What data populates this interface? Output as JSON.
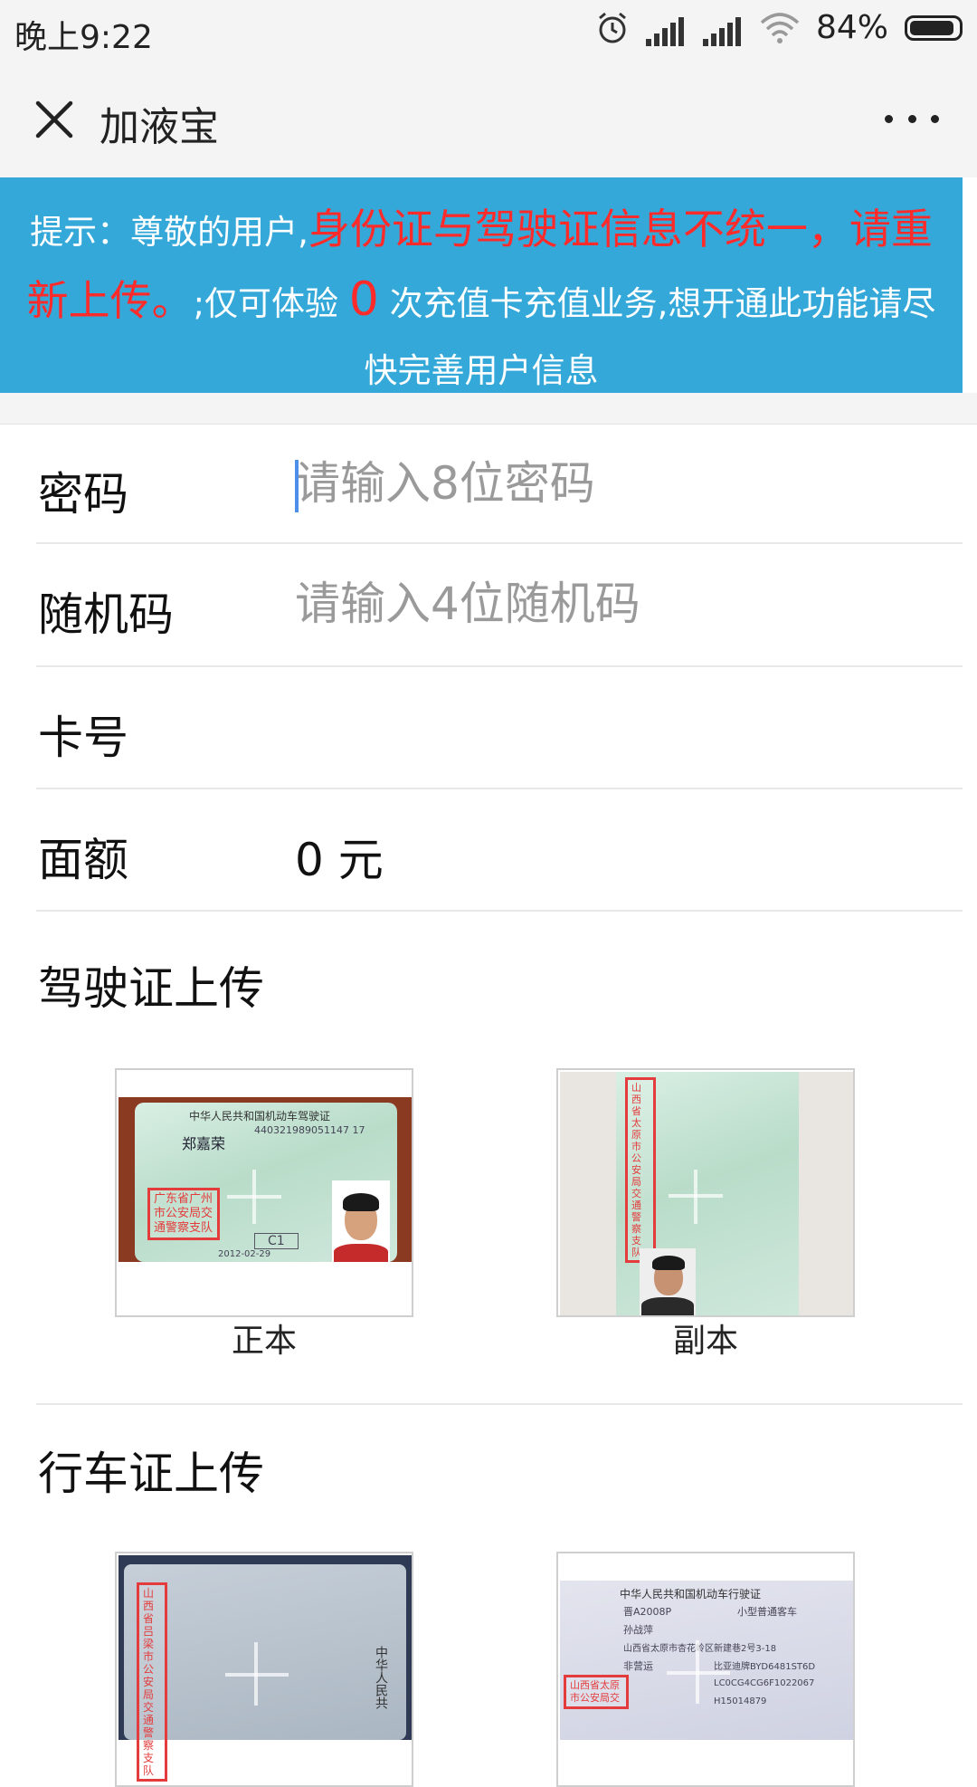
{
  "status_bar": {
    "time": "晚上9:22",
    "battery": "84%",
    "icons": [
      "alarm-icon",
      "signal-icon",
      "signal-icon",
      "wifi-icon",
      "battery-icon"
    ]
  },
  "nav": {
    "title": "加液宝",
    "close_icon": "close-icon",
    "more_icon": "more-icon"
  },
  "notice": {
    "prefix": "提示：尊敬的用户,",
    "warning": "身份证与驾驶证信息不统一，请重新上传。",
    "middle": ";仅可体验",
    "count": "0",
    "suffix": "次充值卡充值业务,想开通此功能请尽快完善用户信息",
    "color_bg": "#34a8d9",
    "color_warning": "#ff2b2b"
  },
  "form": {
    "password": {
      "label": "密码",
      "placeholder": "请输入8位密码"
    },
    "random_code": {
      "label": "随机码",
      "placeholder": "请输入4位随机码"
    },
    "card_no": {
      "label": "卡号",
      "value": ""
    },
    "amount": {
      "label": "面额",
      "value": "0 元"
    }
  },
  "driver_license": {
    "title": "驾驶证上传",
    "front_caption": "正本",
    "back_caption": "副本",
    "front_photo_text": {
      "header": "中华人民共和国机动车驾驶证",
      "name": "郑嘉荣",
      "number": "440321989051147 17",
      "stamp": "广东省广州 市公安局交 通警察支队",
      "class": "C1",
      "date": "2012-02-29"
    },
    "back_photo_text": {
      "stamp": "山西省太原 市公安局交 通警察支队"
    }
  },
  "vehicle_license": {
    "title": "行车证上传",
    "front_photo_text": {
      "stamp": "山西省吕梁 市公安局交 通警察支队",
      "header": "中华人民共"
    },
    "back_photo_text": {
      "header": "中华人民共和国机动车行驶证",
      "plate": "晋A2008P",
      "type": "小型普通客车",
      "owner": "孙战萍",
      "address": "山西省太原市杏花岭区新建巷2号3-18",
      "use": "非营运",
      "model": "比亚迪牌BYD6481ST6D",
      "vin": "LC0CG4CG6F1022067",
      "engine": "H15014879",
      "stamp": "山西省太原 市公安局交"
    }
  }
}
